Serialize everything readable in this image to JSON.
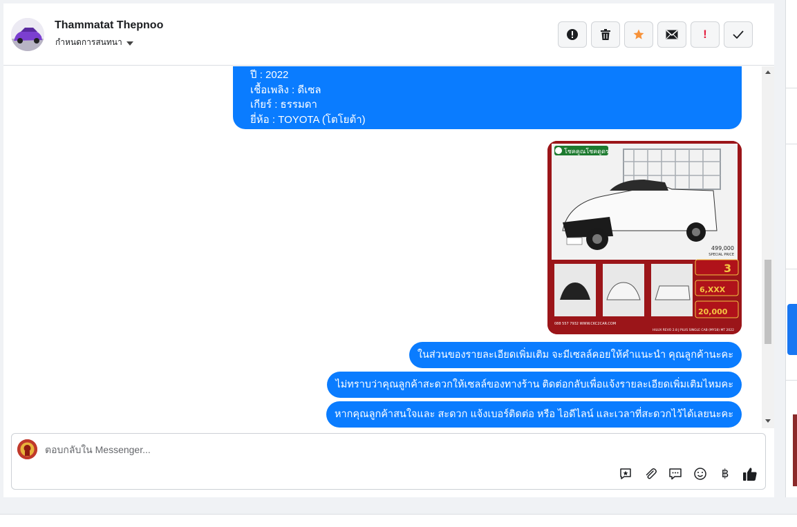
{
  "header": {
    "contact_name": "Thammatat Thepnoo",
    "assign_label": "กำหนดการสนทนา"
  },
  "actions": [
    {
      "name": "report-button",
      "icon": "alert-circle-icon",
      "glyph": "!"
    },
    {
      "name": "delete-button",
      "icon": "trash-icon"
    },
    {
      "name": "star-button",
      "icon": "star-icon"
    },
    {
      "name": "mark-unread-button",
      "icon": "envelope-icon"
    },
    {
      "name": "important-button",
      "icon": "exclamation-icon",
      "glyph": "!"
    },
    {
      "name": "done-button",
      "icon": "checkmark-icon"
    }
  ],
  "messages": {
    "details": [
      "ปี : 2022",
      "เชื้อเพลิง : ดีเซล",
      "เกียร์ : ธรรมดา",
      "ยี่ห้อ : TOYOTA (โตโยต้า)"
    ],
    "image_text": {
      "brand_banner": "โชคคูณโชคดูดร",
      "price": "499,000",
      "price_note": "SPECIAL PRICE",
      "promo_1": "3",
      "promo_2": "6,XXX",
      "promo_3": "20,000",
      "phone": "088 557 7932 WWW.CKC2CAR.COM",
      "model": "HILUX REVO 2.8 J PLUS SINGLE CAB (MY18) MT 2022"
    },
    "pill_1": "ในส่วนของรายละเอียดเพิ่มเติม จะมีเซลล์คอยให้คำแนะนำ คุณลูกค้านะคะ",
    "pill_2": "ไม่ทราบว่าคุณลูกค้าสะดวกให้เซลล์ของทางร้าน ติดต่อกลับเพื่อแจ้งรายละเอียดเพิ่มเติมไหมคะ",
    "pill_3": "หากคุณลูกค้าสนใจและ สะดวก แจ้งเบอร์ติดต่อ หรือ ไอดีไลน์ และเวลาที่สะดวกไว้ได้เลยนะคะ"
  },
  "composer": {
    "placeholder": "ตอบกลับใน Messenger...",
    "tools": [
      "saved-reply-icon",
      "attachment-icon",
      "comment-icon",
      "emoji-icon",
      "baht-icon",
      "thumbs-up-icon"
    ],
    "baht_glyph": "฿"
  },
  "colors": {
    "bubble": "#0a7cff",
    "star": "#f7923a",
    "important": "#e41e3f"
  }
}
